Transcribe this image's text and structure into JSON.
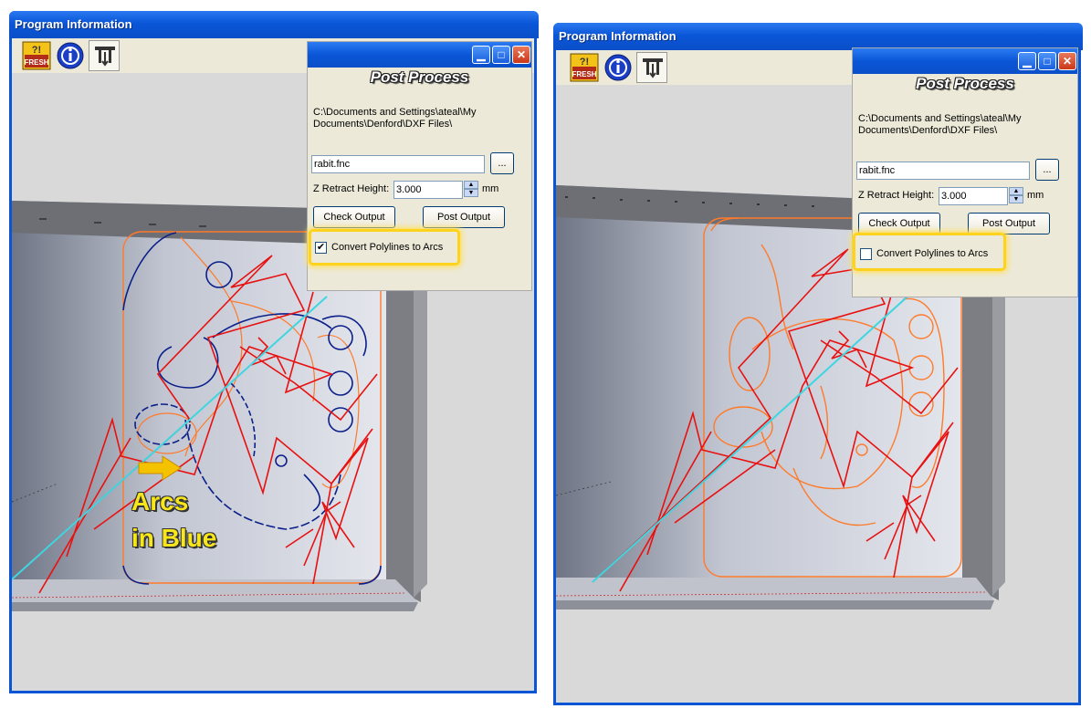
{
  "left": {
    "window_title": "Program Information",
    "dialog": {
      "heading": "Post Process",
      "path": "C:\\Documents and Settings\\ateal\\My\nDocuments\\Denford\\DXF Files\\",
      "filename": "rabit.fnc",
      "browse_label": "...",
      "z_label": "Z Retract Height:",
      "z_value": "3.000",
      "unit": "mm",
      "check_output": "Check Output",
      "post_output": "Post Output",
      "convert_label": "Convert Polylines to Arcs",
      "convert_checked": "✔"
    },
    "annotation_line1": "Arcs",
    "annotation_line2": "in Blue"
  },
  "right": {
    "window_title": "Program Information",
    "dialog": {
      "heading": "Post Process",
      "path": "C:\\Documents and Settings\\ateal\\My\nDocuments\\Denford\\DXF Files\\",
      "filename": "rabit.fnc",
      "browse_label": "...",
      "z_label": "Z Retract Height:",
      "z_value": "3.000",
      "unit": "mm",
      "check_output": "Check Output",
      "post_output": "Post Output",
      "convert_label": "Convert Polylines to Arcs",
      "convert_checked": ""
    }
  },
  "toolbar": {
    "refresh_label": "RE FRESH",
    "info_icon": "info-icon",
    "fixture_icon": "fixture-icon"
  },
  "colors": {
    "arcs": "#0b1f8a",
    "polylines": "#ff7a2a",
    "toolpath": "#e81010",
    "diagonal": "#3ed6e0",
    "highlight": "#ffd21c"
  }
}
